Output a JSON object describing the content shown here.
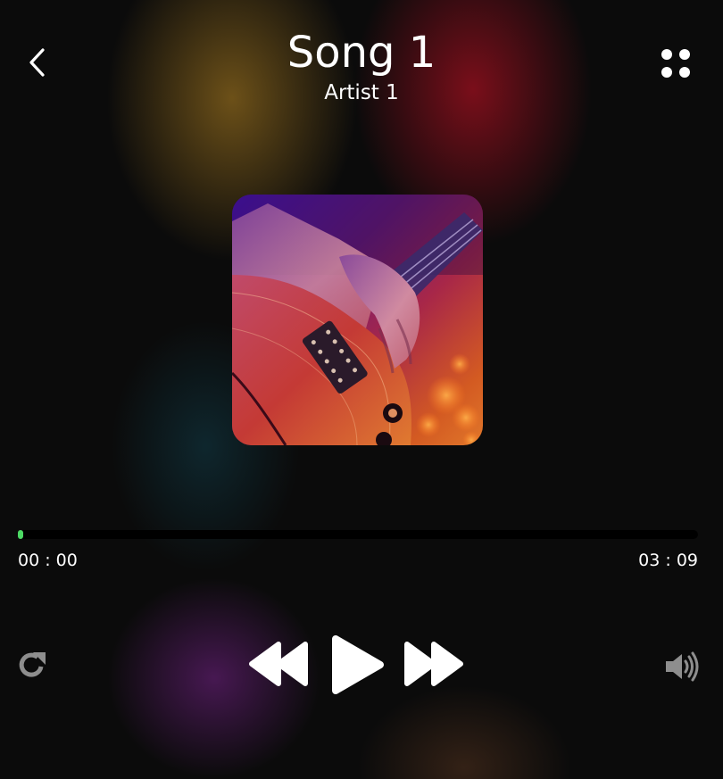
{
  "header": {
    "title": "Song 1",
    "artist": "Artist 1"
  },
  "playback": {
    "current_time": "00 : 00",
    "total_time": "03 : 09",
    "progress_fraction": 0.004
  },
  "icons": {
    "back": "chevron-left-icon",
    "menu": "four-dots-grid-icon",
    "repeat": "repeat-icon",
    "rewind": "rewind-icon",
    "play": "play-icon",
    "forward": "fast-forward-icon",
    "volume": "volume-icon"
  },
  "colors": {
    "background": "#0b0b0b",
    "progress_accent": "#4cd964",
    "track": "#000000",
    "text": "#ffffff",
    "muted_icon": "#8e8e8e"
  }
}
